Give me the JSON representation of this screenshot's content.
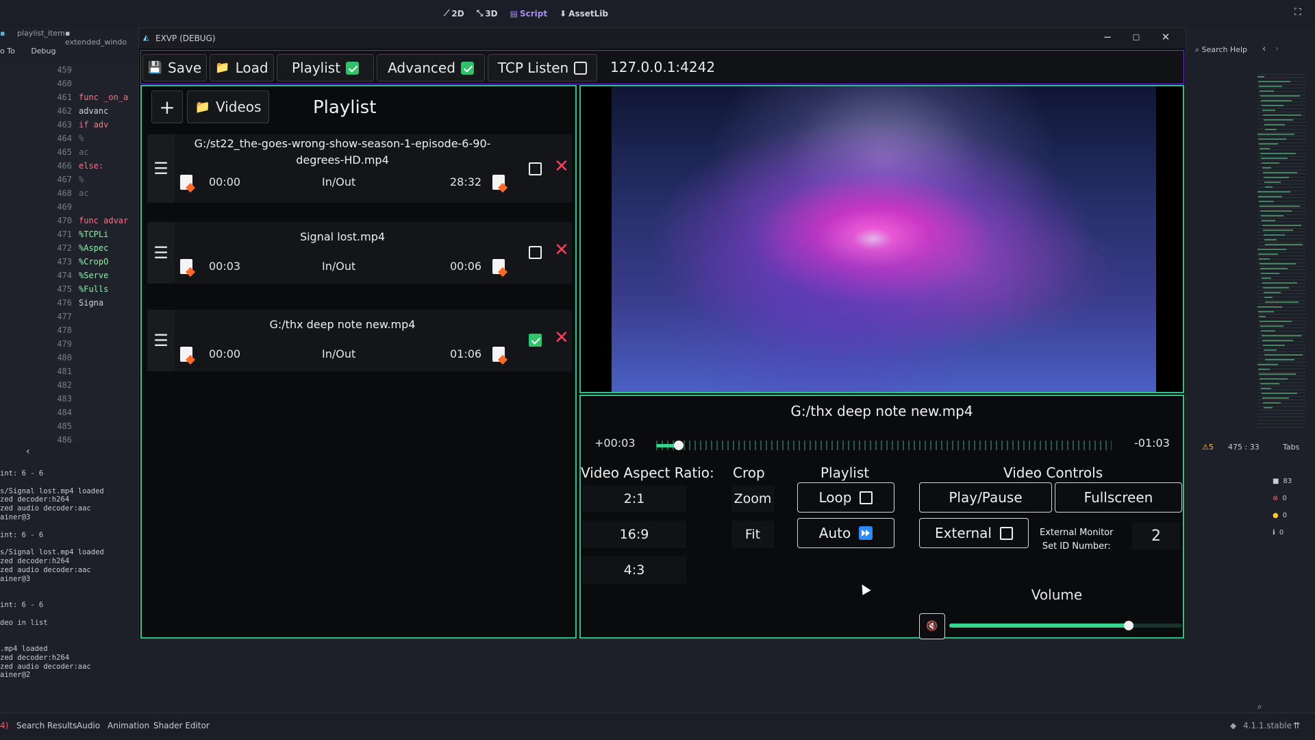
{
  "editor": {
    "workspaces": [
      {
        "label": "2D",
        "icon": "2d-icon"
      },
      {
        "label": "3D",
        "icon": "3d-icon"
      },
      {
        "label": "Script",
        "icon": "script-icon"
      },
      {
        "label": "AssetLib",
        "icon": "assetlib-icon"
      }
    ],
    "script_tabs": [
      "playlist_item",
      "extended_windo"
    ],
    "menu": [
      "o To",
      "Debug"
    ],
    "search_help": "Search Help",
    "line_numbers": [
      "459",
      "460",
      "461",
      "462",
      "463",
      "464",
      "465",
      "466",
      "467",
      "468",
      "469",
      "470",
      "471",
      "472",
      "473",
      "474",
      "475",
      "476",
      "477",
      "478",
      "479",
      "480",
      "481",
      "482",
      "483",
      "484",
      "485",
      "486"
    ],
    "code_lines": [
      {
        "t": "",
        "c": "plain"
      },
      {
        "t": "",
        "c": "plain"
      },
      {
        "t": "func _on_a",
        "c": "kw"
      },
      {
        "t": "  advanc",
        "c": "plain"
      },
      {
        "t": "  if adv",
        "c": "kw"
      },
      {
        "t": "    %",
        "c": "faint"
      },
      {
        "t": "    ac",
        "c": "faint"
      },
      {
        "t": "  else:",
        "c": "kw"
      },
      {
        "t": "    %",
        "c": "faint"
      },
      {
        "t": "    ac",
        "c": "faint"
      },
      {
        "t": "",
        "c": "plain"
      },
      {
        "t": "func advar",
        "c": "kw"
      },
      {
        "t": "  %TCPLi",
        "c": "sym"
      },
      {
        "t": "  %Aspec",
        "c": "sym"
      },
      {
        "t": "  %CropO",
        "c": "sym"
      },
      {
        "t": "  %Serve",
        "c": "sym"
      },
      {
        "t": "  %Fulls",
        "c": "sym"
      },
      {
        "t": "  Signa",
        "c": "plain"
      },
      {
        "t": "",
        "c": "plain"
      }
    ],
    "console_lines": [
      "int: 6 - 6",
      "",
      "s/Signal lost.mp4 loaded",
      "zed decoder:h264",
      "zed audio decoder:aac",
      "ainer@3",
      "",
      "int: 6 - 6",
      "",
      "s/Signal lost.mp4 loaded",
      "zed decoder:h264",
      "zed audio decoder:aac",
      "ainer@3",
      "",
      "",
      "int: 6 - 6",
      "",
      "deo in list",
      "",
      "",
      ".mp4 loaded",
      "zed decoder:h264",
      "zed audio decoder:aac",
      "ainer@2"
    ],
    "status_position": "475 :   33",
    "status_indent": "Tabs",
    "warnings": "5",
    "bottom_tabs": [
      "4)",
      "Search Results",
      "Audio",
      "Animation",
      "Shader Editor"
    ],
    "version": "4.1.1.stable",
    "side_counts": [
      "83",
      "0",
      "0",
      "0"
    ]
  },
  "window": {
    "title": "EXVP (DEBUG)",
    "toolbar": {
      "save": "Save",
      "load": "Load",
      "playlist": "Playlist",
      "playlist_checked": true,
      "advanced": "Advanced",
      "advanced_checked": true,
      "tcp_listen": "TCP Listen",
      "tcp_checked": false,
      "address": "127.0.0.1:4242"
    }
  },
  "playlist_panel": {
    "add_button": "+",
    "videos_button": "Videos",
    "title": "Playlist",
    "items": [
      {
        "name": "G:/st22_the-goes-wrong-show-season-1-episode-6-90-degrees-HD.mp4",
        "in_time": "00:00",
        "mode": "In/Out",
        "out_time": "28:32",
        "checked": false
      },
      {
        "name": "Signal lost.mp4",
        "in_time": "00:03",
        "mode": "In/Out",
        "out_time": "00:06",
        "checked": false
      },
      {
        "name": "G:/thx deep note new.mp4",
        "in_time": "00:00",
        "mode": "In/Out",
        "out_time": "01:06",
        "checked": true
      }
    ]
  },
  "player": {
    "now_playing": "G:/thx deep note new.mp4",
    "elapsed": "+00:03",
    "remaining": "-01:03",
    "progress": 0.05,
    "aspect_header": "Video Aspect Ratio:",
    "aspect_options": [
      "2:1",
      "16:9",
      "4:3"
    ],
    "crop_header": "Crop",
    "crop_options": [
      "Zoom",
      "Fit"
    ],
    "playlist_header": "Playlist",
    "loop_label": "Loop",
    "loop_checked": false,
    "auto_label": "Auto",
    "controls_header": "Video Controls",
    "play_pause": "Play/Pause",
    "fullscreen": "Fullscreen",
    "external_label": "External",
    "external_checked": false,
    "external_monitor_line1": "External Monitor",
    "external_monitor_line2": "Set ID Number:",
    "external_id": "2",
    "volume_header": "Volume",
    "volume": 0.77
  },
  "colors": {
    "accent_green": "#2cc48a",
    "toolbar_border": "#7a2dd6",
    "delete_red": "#ff3d5c"
  }
}
